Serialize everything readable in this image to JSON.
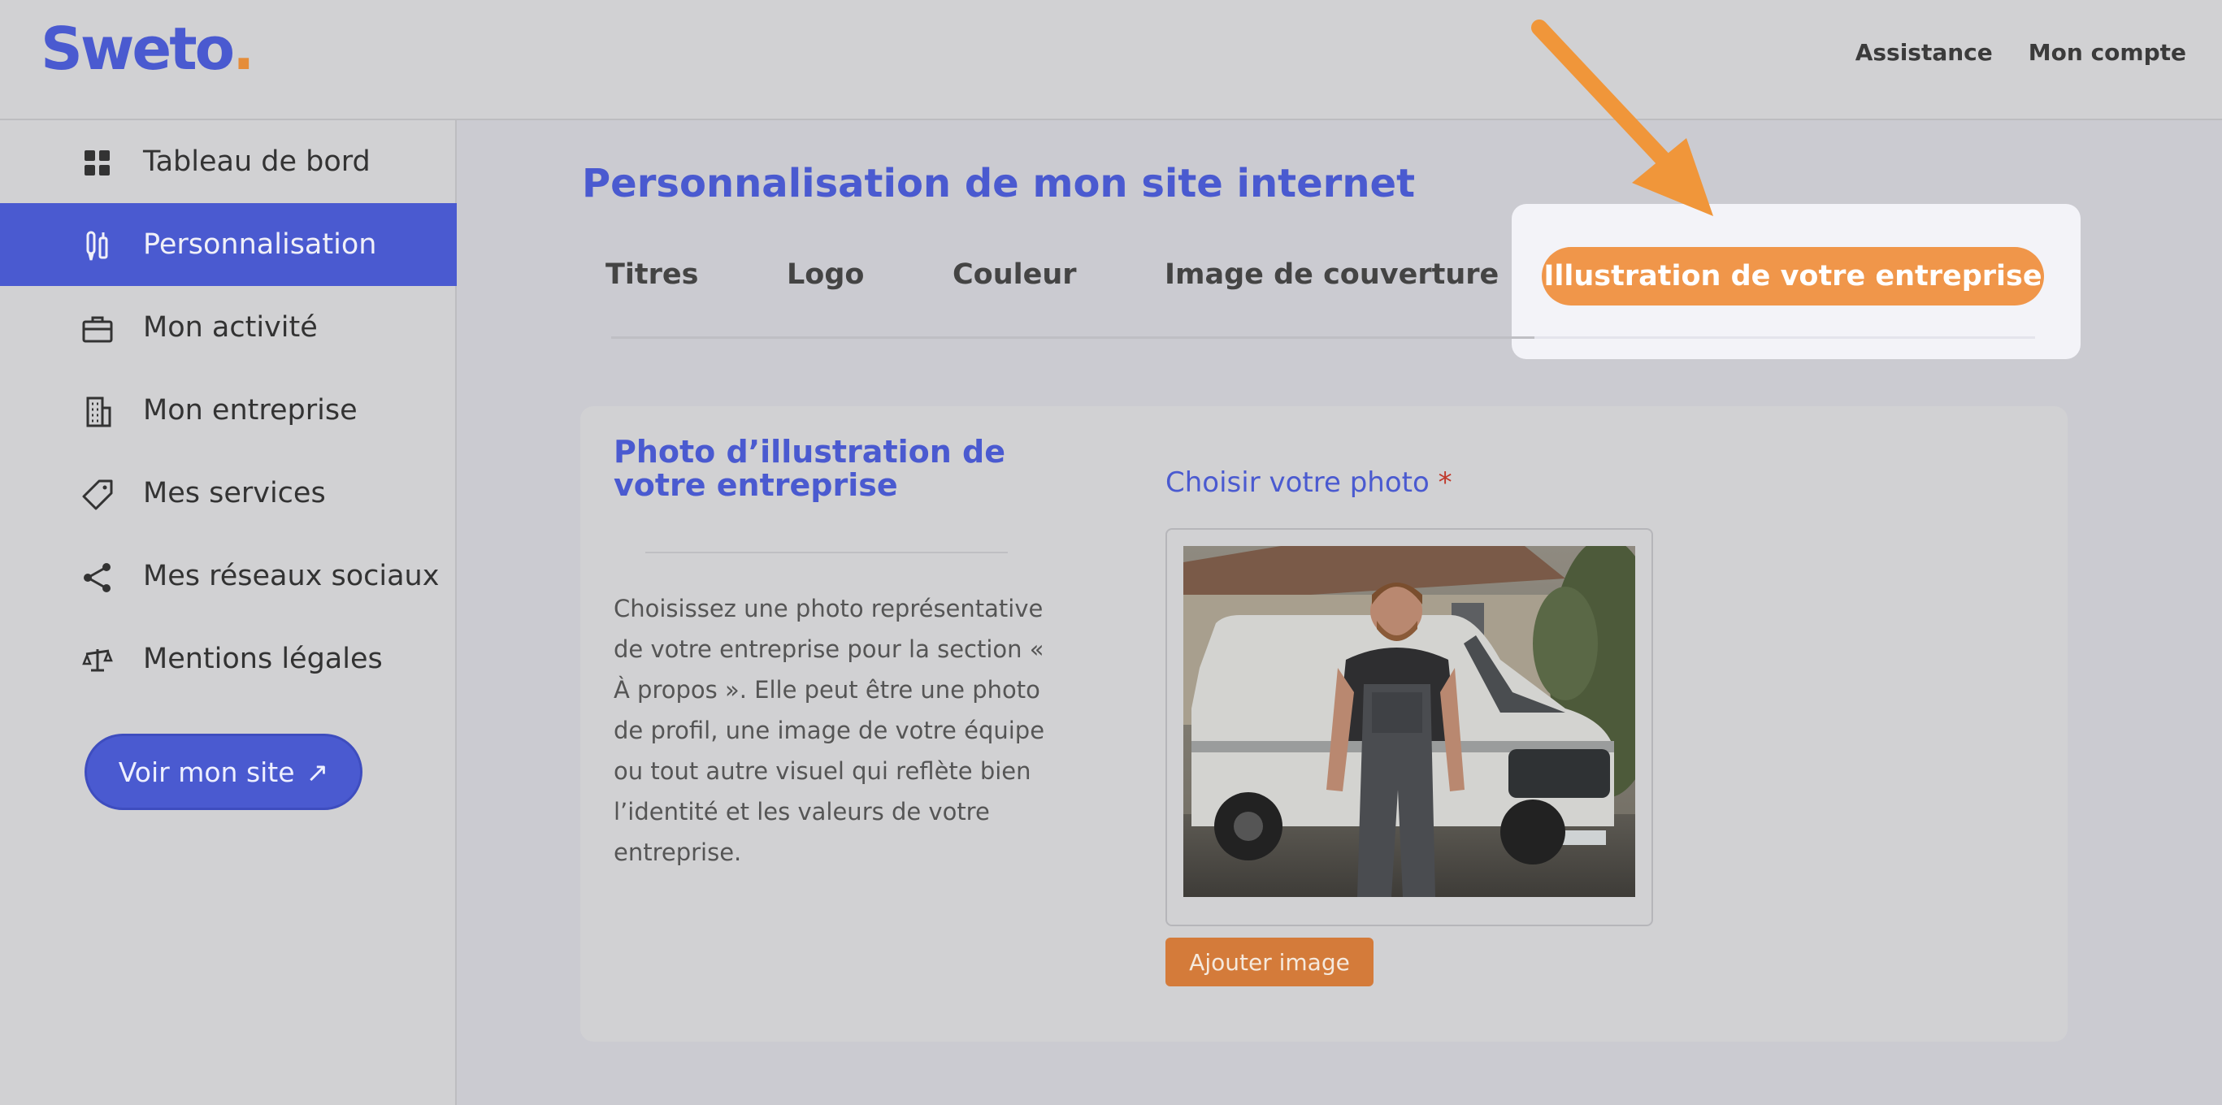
{
  "brand": {
    "name": "Sweto",
    "dot": ".",
    "accent": "#4a5ad0",
    "dot_color": "#e58d3a"
  },
  "topnav": {
    "assistance": "Assistance",
    "account": "Mon compte"
  },
  "sidebar": {
    "items": [
      {
        "label": "Tableau de bord",
        "icon": "grid-icon"
      },
      {
        "label": "Personnalisation",
        "icon": "brushes-icon",
        "active": true
      },
      {
        "label": "Mon activité",
        "icon": "briefcase-icon"
      },
      {
        "label": "Mon entreprise",
        "icon": "building-icon"
      },
      {
        "label": "Mes services",
        "icon": "tag-icon"
      },
      {
        "label": "Mes réseaux sociaux",
        "icon": "share-icon"
      },
      {
        "label": "Mentions légales",
        "icon": "scales-icon"
      }
    ],
    "view_site": "Voir mon site",
    "view_site_icon": "↗"
  },
  "main": {
    "title": "Personnalisation de mon site internet",
    "tabs": [
      "Titres",
      "Logo",
      "Couleur",
      "Image de couverture"
    ],
    "active_tab": "Illustration de votre entreprise",
    "highlight_color": "#f0964a"
  },
  "card": {
    "title": "Photo d’illustration de votre entreprise",
    "description": "Choisissez une photo représentative de votre entreprise pour la section « À propos ». Elle peut être une photo de profil, une image de votre équipe ou tout autre visuel qui reflète bien l’identité et les valeurs de votre entreprise.",
    "field_label": "Choisir votre photo",
    "required_mark": "*",
    "add_button": "Ajouter image"
  }
}
